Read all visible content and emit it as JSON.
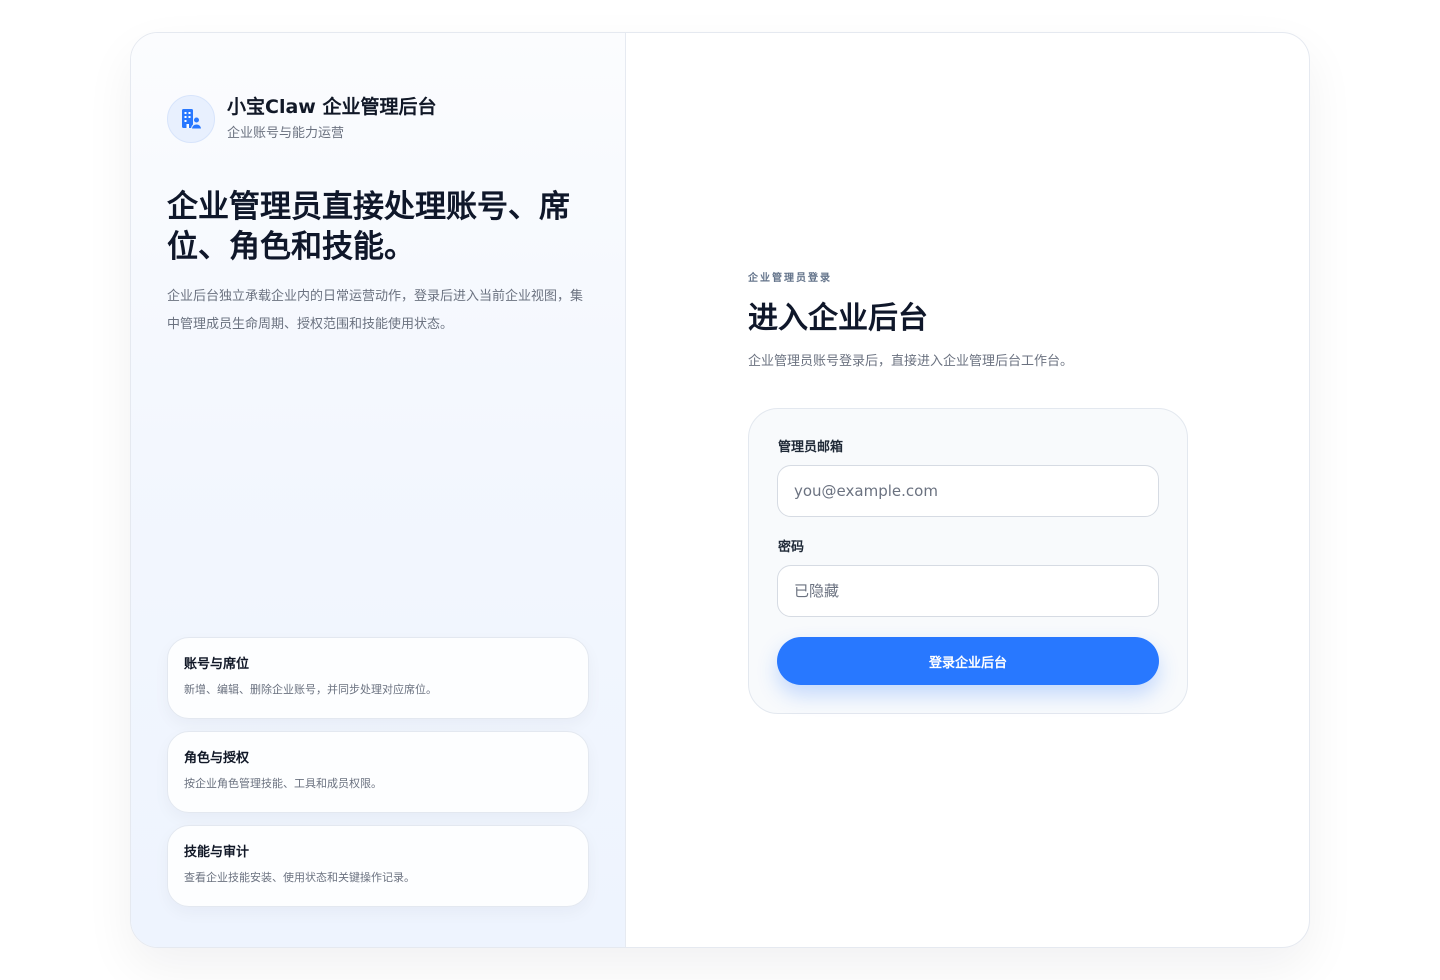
{
  "brand": {
    "title": "小宝Claw 企业管理后台",
    "subtitle": "企业账号与能力运营",
    "icon": "building-user-icon"
  },
  "hero": {
    "title": "企业管理员直接处理账号、席位、角色和技能。",
    "description": "企业后台独立承载企业内的日常运营动作，登录后进入当前企业视图，集中管理成员生命周期、授权范围和技能使用状态。"
  },
  "features": [
    {
      "title": "账号与席位",
      "description": "新增、编辑、删除企业账号，并同步处理对应席位。"
    },
    {
      "title": "角色与授权",
      "description": "按企业角色管理技能、工具和成员权限。"
    },
    {
      "title": "技能与审计",
      "description": "查看企业技能安装、使用状态和关键操作记录。"
    }
  ],
  "login": {
    "eyebrow": "企业管理员登录",
    "title": "进入企业后台",
    "description": "企业管理员账号登录后，直接进入企业管理后台工作台。",
    "email": {
      "label": "管理员邮箱",
      "placeholder": "you@example.com",
      "value": ""
    },
    "password": {
      "label": "密码",
      "placeholder": "已隐藏",
      "value": ""
    },
    "submit_label": "登录企业后台"
  },
  "colors": {
    "accent": "#2878ff",
    "text_primary": "#0f172a",
    "text_muted": "#6b7280"
  }
}
